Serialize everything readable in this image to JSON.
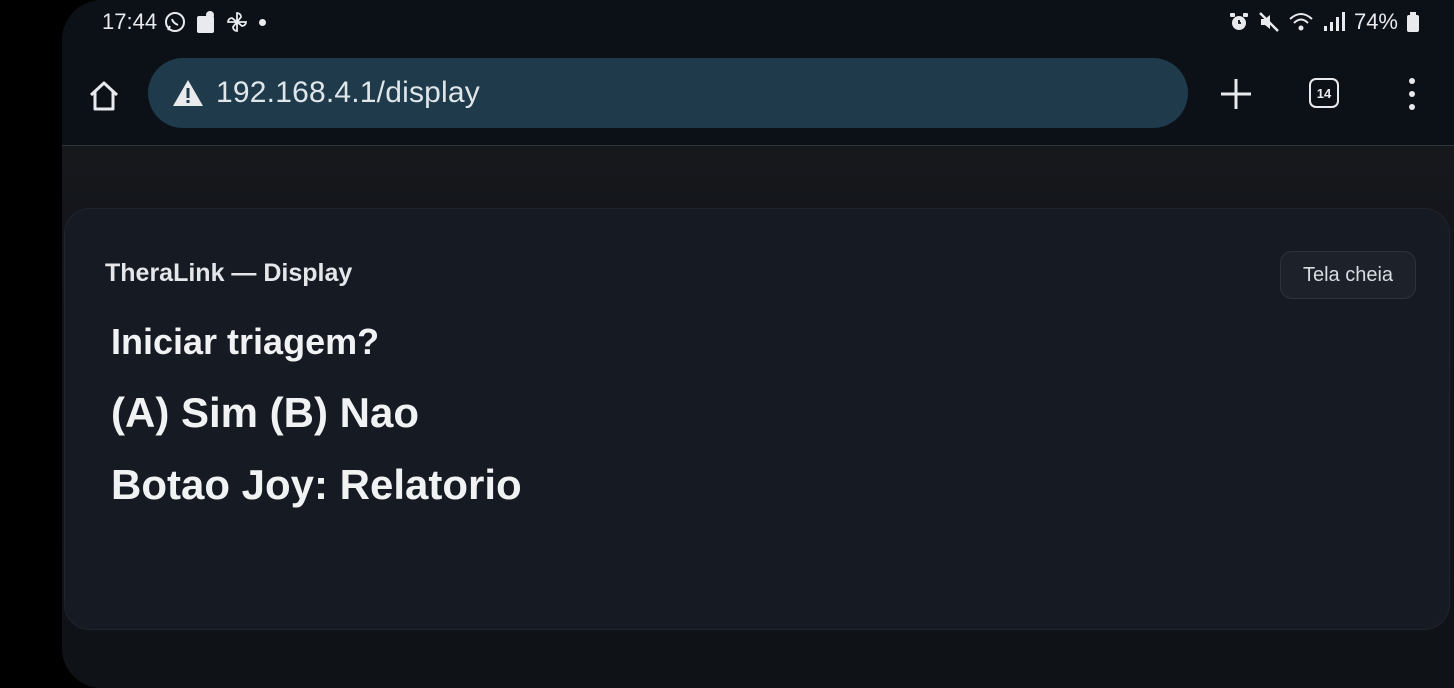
{
  "status_bar": {
    "time": "17:44",
    "battery": "74%",
    "icons_left": [
      "whatsapp-icon",
      "notification-icon",
      "pinwheel-icon",
      "dot-icon"
    ],
    "icons_right": [
      "alarm-icon",
      "mute-icon",
      "wifi-icon",
      "signal-icon",
      "battery-icon"
    ]
  },
  "browser": {
    "url": "192.168.4.1/display",
    "tab_count": "14",
    "icons": [
      "home-icon",
      "not-secure-warning-icon",
      "new-tab-plus-icon",
      "tab-switcher-icon",
      "more-menu-icon"
    ]
  },
  "card": {
    "title": "TheraLink — Display",
    "fullscreen_button": "Tela cheia",
    "lines": [
      "Iniciar triagem?",
      "(A) Sim (B) Nao",
      "Botao Joy: Relatorio"
    ]
  },
  "colors": {
    "omnibox_bg": "#1f3a4a",
    "card_bg": "#161a23",
    "page_bg": "#111419",
    "text": "#f1f2f4"
  }
}
